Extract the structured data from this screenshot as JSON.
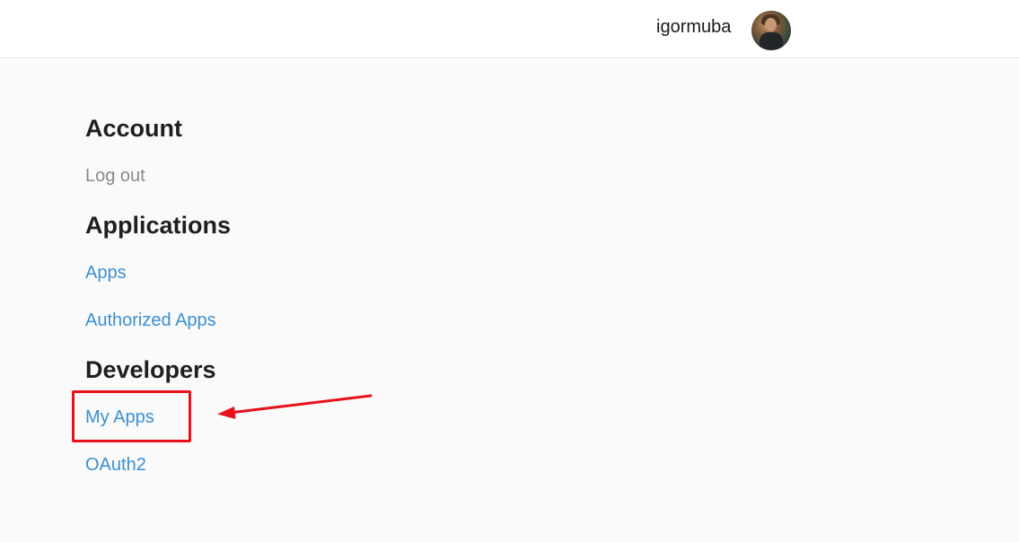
{
  "header": {
    "username": "igormuba",
    "avatar_icon": "user-avatar"
  },
  "sections": [
    {
      "heading": "Account",
      "items": [
        {
          "label": "Log out",
          "style": "muted"
        }
      ]
    },
    {
      "heading": "Applications",
      "items": [
        {
          "label": "Apps",
          "style": "link"
        },
        {
          "label": "Authorized Apps",
          "style": "link"
        }
      ]
    },
    {
      "heading": "Developers",
      "items": [
        {
          "label": "My Apps",
          "style": "link",
          "highlighted": true
        },
        {
          "label": "OAuth2",
          "style": "link"
        }
      ]
    }
  ],
  "annotation": {
    "highlight_color": "#e8101a",
    "target": "My Apps"
  },
  "colors": {
    "link": "#3a8fd1",
    "muted": "#8a8a8a",
    "heading": "#1f1f1f",
    "background": "#fafafa"
  }
}
